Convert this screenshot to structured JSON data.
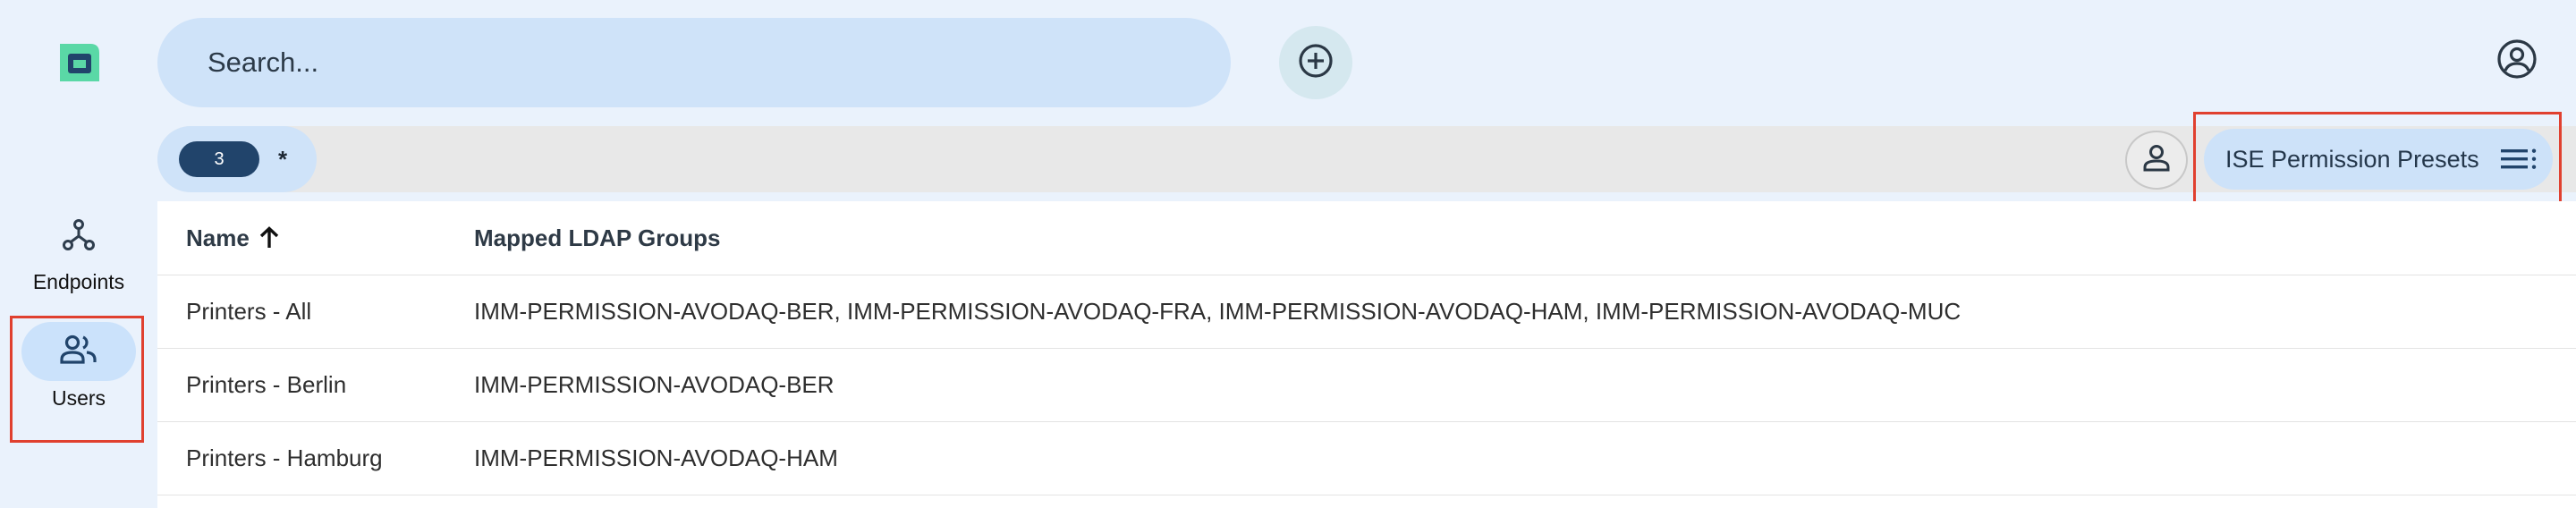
{
  "nav": {
    "items": [
      {
        "label": "Endpoints",
        "icon": "graph-nodes-icon"
      },
      {
        "label": "Users",
        "icon": "people-icon",
        "selected": true
      }
    ]
  },
  "search": {
    "placeholder": "Search..."
  },
  "filters": {
    "count": "3",
    "wildcard": "*",
    "preset_label": "ISE Permission Presets"
  },
  "table": {
    "columns": [
      {
        "label": "Name",
        "sort": "ascending"
      },
      {
        "label": "Mapped LDAP Groups"
      }
    ],
    "rows": [
      {
        "name": "Printers - All",
        "groups": "IMM-PERMISSION-AVODAQ-BER, IMM-PERMISSION-AVODAQ-FRA, IMM-PERMISSION-AVODAQ-HAM, IMM-PERMISSION-AVODAQ-MUC"
      },
      {
        "name": "Printers - Berlin",
        "groups": "IMM-PERMISSION-AVODAQ-BER"
      },
      {
        "name": "Printers - Hamburg",
        "groups": "IMM-PERMISSION-AVODAQ-HAM"
      }
    ]
  },
  "colors": {
    "accent": "#21446b",
    "highlight": "#e0402f",
    "brand": "#5ad8a6"
  }
}
